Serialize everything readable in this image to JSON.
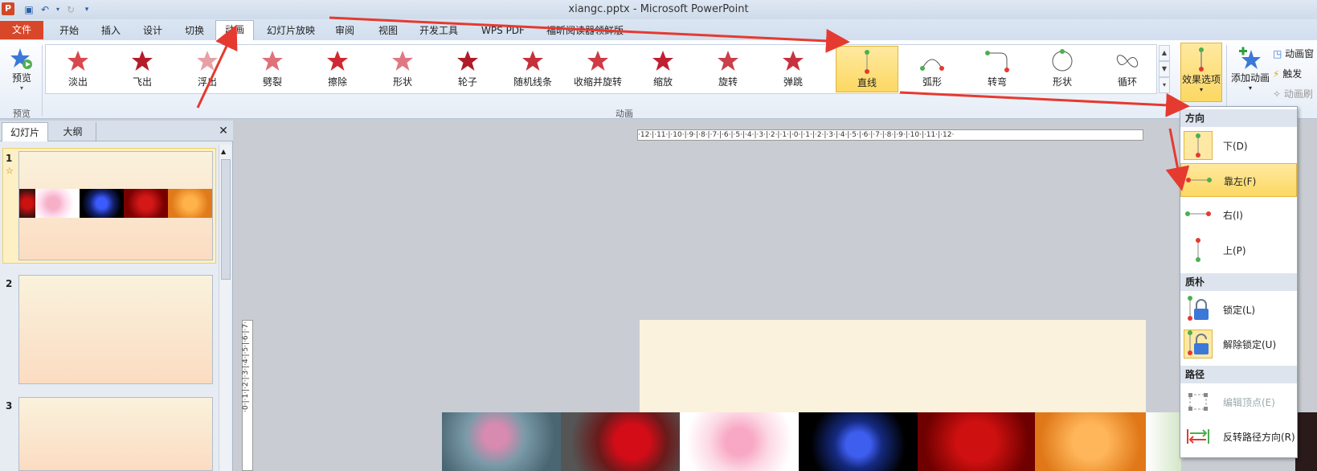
{
  "window": {
    "title": "xiangc.pptx  -  Microsoft PowerPoint"
  },
  "tabs": {
    "file": "文件",
    "items": [
      "开始",
      "插入",
      "设计",
      "切换",
      "动画",
      "幻灯片放映",
      "审阅",
      "视图",
      "开发工具",
      "WPS PDF",
      "福昕阅读器领鲜版"
    ],
    "active": "动画"
  },
  "ribbon": {
    "preview_label": "预览",
    "preview_group": "预览",
    "animation_group": "动画",
    "gallery": [
      "淡出",
      "飞出",
      "浮出",
      "劈裂",
      "擦除",
      "形状",
      "轮子",
      "随机线条",
      "收缩并旋转",
      "缩放",
      "旋转",
      "弹跳",
      "直线",
      "弧形",
      "转弯",
      "形状",
      "循环"
    ],
    "selected": "直线",
    "effect_options": "效果选项",
    "add_animation": "添加动画",
    "right_items": [
      "动画窗",
      "触发",
      "动画刷"
    ]
  },
  "panel": {
    "tabs": [
      "幻灯片",
      "大纲"
    ],
    "close": "✕",
    "slides": [
      "1",
      "2",
      "3"
    ]
  },
  "ruler": {
    "h_text": "·12·|·11·|·10·|·9·|·8·|·7·|·6·|·5·|·4·|·3·|·2·|·1·|·0·|·1·|·2·|·3·|·4·|·5·|·6·|·7·|·8·|·9·|·10·|·11·|·12·",
    "v_text": "·0·|·1·|·2·|·3·|·4·|·5·|·6·|·7·"
  },
  "dropdown": {
    "section_direction": "方向",
    "direction_items": [
      "下(D)",
      "靠左(F)",
      "右(I)",
      "上(P)"
    ],
    "highlighted": "靠左(F)",
    "section_origin": "质朴",
    "origin_items": [
      "锁定(L)",
      "解除锁定(U)"
    ],
    "section_path": "路径",
    "path_items": [
      "编辑顶点(E)",
      "反转路径方向(R)"
    ]
  },
  "colors": {
    "accent": "#d9472b",
    "highlight": "#fcd862",
    "annotation_arrow": "#e53a30"
  }
}
